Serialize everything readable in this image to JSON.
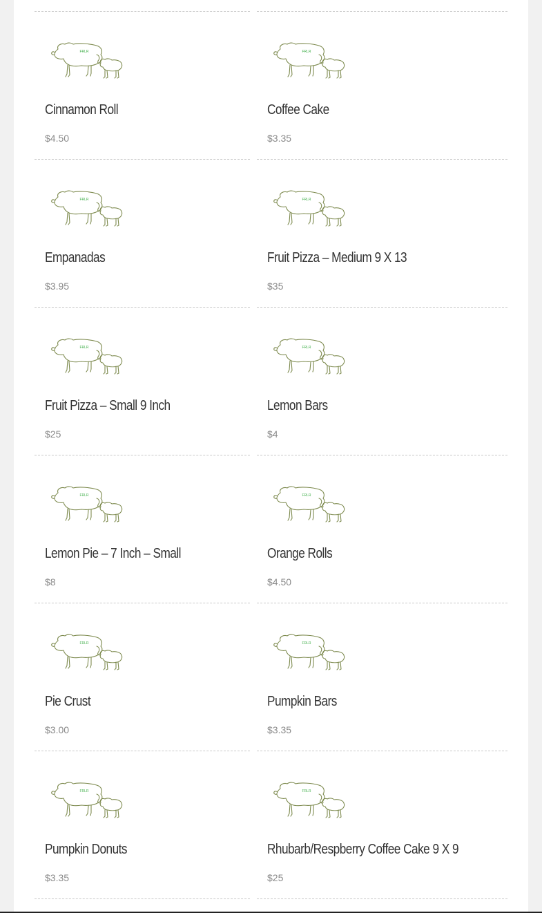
{
  "products": [
    {
      "name": "Cinnamon Roll",
      "price": "$4.50",
      "image": "sheep-logo-icon"
    },
    {
      "name": "Coffee Cake",
      "price": "$3.35",
      "image": "sheep-logo-icon"
    },
    {
      "name": "Empanadas",
      "price": "$3.95",
      "image": "sheep-logo-icon"
    },
    {
      "name": "Fruit Pizza – Medium 9 X 13",
      "price": "$35",
      "image": "sheep-logo-icon"
    },
    {
      "name": "Fruit Pizza – Small 9 Inch",
      "price": "$25",
      "image": "sheep-logo-icon"
    },
    {
      "name": "Lemon Bars",
      "price": "$4",
      "image": "sheep-logo-icon"
    },
    {
      "name": "Lemon Pie – 7 Inch – Small",
      "price": "$8",
      "image": "sheep-logo-icon"
    },
    {
      "name": "Orange Rolls",
      "price": "$4.50",
      "image": "sheep-logo-icon"
    },
    {
      "name": "Pie Crust",
      "price": "$3.00",
      "image": "sheep-logo-icon"
    },
    {
      "name": "Pumpkin Bars",
      "price": "$3.35",
      "image": "sheep-logo-icon"
    },
    {
      "name": "Pumpkin Donuts",
      "price": "$3.35",
      "image": "sheep-logo-icon"
    },
    {
      "name": "Rhubarb/Respberry Coffee Cake 9 X 9",
      "price": "$25",
      "image": "sheep-logo-icon"
    }
  ],
  "colors": {
    "sheep_outline": "#7d8a4e",
    "logo_text": "#3fae49",
    "title_text": "#333333",
    "price_text": "#8a8a8a",
    "divider": "#c8c8c8"
  }
}
